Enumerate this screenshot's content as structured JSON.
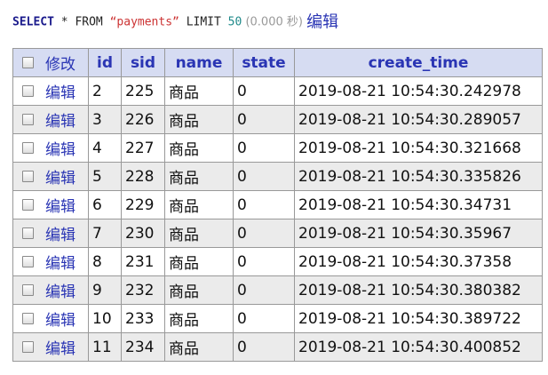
{
  "query": {
    "select": "SELECT",
    "star_from": " * FROM ",
    "table": "“payments”",
    "limit_kw": " LIMIT ",
    "limit_value": "50",
    "timing": " (0.000 秒) ",
    "edit_label": "编辑"
  },
  "table": {
    "header": {
      "modify": "修改",
      "id": "id",
      "sid": "sid",
      "name": "name",
      "state": "state",
      "create_time": "create_time"
    },
    "rows": [
      {
        "edit": "编辑",
        "id": "2",
        "sid": "225",
        "name": "商品",
        "state": "0",
        "create_time": "2019-08-21 10:54:30.242978"
      },
      {
        "edit": "编辑",
        "id": "3",
        "sid": "226",
        "name": "商品",
        "state": "0",
        "create_time": "2019-08-21 10:54:30.289057"
      },
      {
        "edit": "编辑",
        "id": "4",
        "sid": "227",
        "name": "商品",
        "state": "0",
        "create_time": "2019-08-21 10:54:30.321668"
      },
      {
        "edit": "编辑",
        "id": "5",
        "sid": "228",
        "name": "商品",
        "state": "0",
        "create_time": "2019-08-21 10:54:30.335826"
      },
      {
        "edit": "编辑",
        "id": "6",
        "sid": "229",
        "name": "商品",
        "state": "0",
        "create_time": "2019-08-21 10:54:30.34731"
      },
      {
        "edit": "编辑",
        "id": "7",
        "sid": "230",
        "name": "商品",
        "state": "0",
        "create_time": "2019-08-21 10:54:30.35967"
      },
      {
        "edit": "编辑",
        "id": "8",
        "sid": "231",
        "name": "商品",
        "state": "0",
        "create_time": "2019-08-21 10:54:30.37358"
      },
      {
        "edit": "编辑",
        "id": "9",
        "sid": "232",
        "name": "商品",
        "state": "0",
        "create_time": "2019-08-21 10:54:30.380382"
      },
      {
        "edit": "编辑",
        "id": "10",
        "sid": "233",
        "name": "商品",
        "state": "0",
        "create_time": "2019-08-21 10:54:30.389722"
      },
      {
        "edit": "编辑",
        "id": "11",
        "sid": "234",
        "name": "商品",
        "state": "0",
        "create_time": "2019-08-21 10:54:30.400852"
      }
    ]
  },
  "colors": {
    "header_bg": "#d6dcf2",
    "link": "#2a35b4",
    "row_alt": "#ebebeb",
    "sql_keyword": "#1a1a8c",
    "sql_string": "#cc3333",
    "sql_number": "#1f8a8a"
  }
}
